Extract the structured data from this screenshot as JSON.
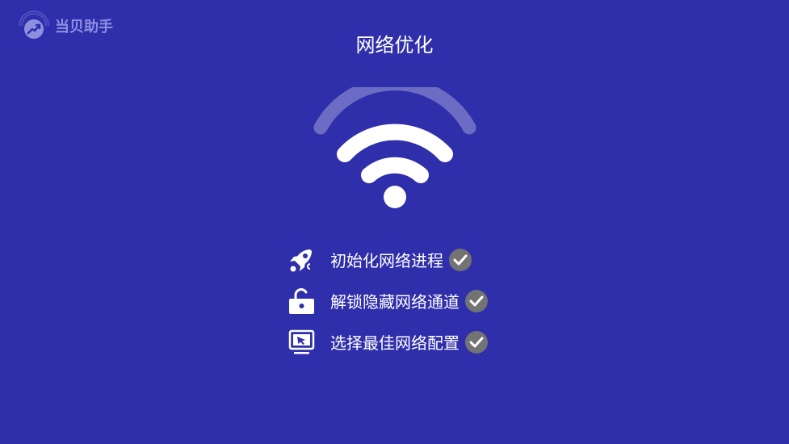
{
  "app": {
    "logo_text": "当贝助手",
    "logo_icon": "dangbei-logo-icon"
  },
  "page": {
    "title": "网络优化"
  },
  "wifi_icon": "wifi-signal-icon",
  "steps": [
    {
      "label": "初始化网络进程",
      "icon": "rocket-icon",
      "status": "completed"
    },
    {
      "label": "解锁隐藏网络通道",
      "icon": "unlock-icon",
      "status": "completed"
    },
    {
      "label": "选择最佳网络配置",
      "icon": "monitor-cursor-icon",
      "status": "completed"
    }
  ],
  "colors": {
    "background": "#2f2eab",
    "text": "#ffffff",
    "logo_text": "#8f8fe0",
    "check_badge": "#737373",
    "wifi_faded_arc": "#6d6cc4"
  }
}
